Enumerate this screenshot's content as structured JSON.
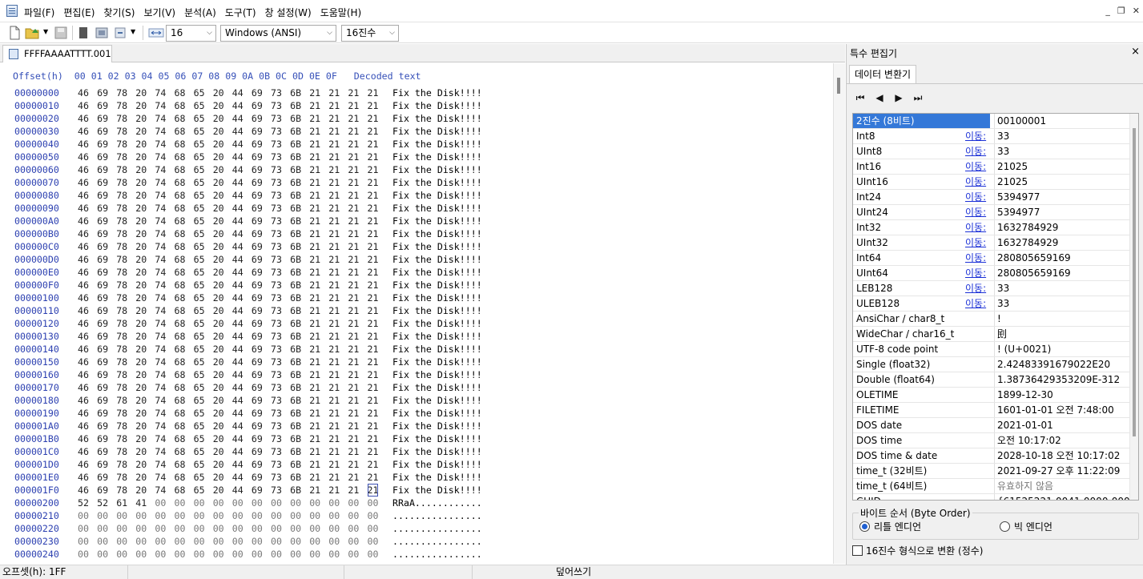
{
  "menu": [
    "파일(F)",
    "편집(E)",
    "찾기(S)",
    "보기(V)",
    "분석(A)",
    "도구(T)",
    "창 설정(W)",
    "도움말(H)"
  ],
  "toolbar": {
    "bytes_per_row": "16",
    "encoding": "Windows (ANSI)",
    "offset_base": "16진수"
  },
  "file_tab": "FFFFAAAATTTT.001",
  "hex_header": "Offset(h)  00 01 02 03 04 05 06 07 08 09 0A 0B 0C 0D 0E 0F   Decoded text",
  "rows": [
    {
      "offset": "00000000",
      "bytes": [
        "46",
        "69",
        "78",
        "20",
        "74",
        "68",
        "65",
        "20",
        "44",
        "69",
        "73",
        "6B",
        "21",
        "21",
        "21",
        "21"
      ],
      "text": "Fix the Disk!!!!"
    },
    {
      "offset": "00000010",
      "bytes": [
        "46",
        "69",
        "78",
        "20",
        "74",
        "68",
        "65",
        "20",
        "44",
        "69",
        "73",
        "6B",
        "21",
        "21",
        "21",
        "21"
      ],
      "text": "Fix the Disk!!!!"
    },
    {
      "offset": "00000020",
      "bytes": [
        "46",
        "69",
        "78",
        "20",
        "74",
        "68",
        "65",
        "20",
        "44",
        "69",
        "73",
        "6B",
        "21",
        "21",
        "21",
        "21"
      ],
      "text": "Fix the Disk!!!!"
    },
    {
      "offset": "00000030",
      "bytes": [
        "46",
        "69",
        "78",
        "20",
        "74",
        "68",
        "65",
        "20",
        "44",
        "69",
        "73",
        "6B",
        "21",
        "21",
        "21",
        "21"
      ],
      "text": "Fix the Disk!!!!"
    },
    {
      "offset": "00000040",
      "bytes": [
        "46",
        "69",
        "78",
        "20",
        "74",
        "68",
        "65",
        "20",
        "44",
        "69",
        "73",
        "6B",
        "21",
        "21",
        "21",
        "21"
      ],
      "text": "Fix the Disk!!!!"
    },
    {
      "offset": "00000050",
      "bytes": [
        "46",
        "69",
        "78",
        "20",
        "74",
        "68",
        "65",
        "20",
        "44",
        "69",
        "73",
        "6B",
        "21",
        "21",
        "21",
        "21"
      ],
      "text": "Fix the Disk!!!!"
    },
    {
      "offset": "00000060",
      "bytes": [
        "46",
        "69",
        "78",
        "20",
        "74",
        "68",
        "65",
        "20",
        "44",
        "69",
        "73",
        "6B",
        "21",
        "21",
        "21",
        "21"
      ],
      "text": "Fix the Disk!!!!"
    },
    {
      "offset": "00000070",
      "bytes": [
        "46",
        "69",
        "78",
        "20",
        "74",
        "68",
        "65",
        "20",
        "44",
        "69",
        "73",
        "6B",
        "21",
        "21",
        "21",
        "21"
      ],
      "text": "Fix the Disk!!!!"
    },
    {
      "offset": "00000080",
      "bytes": [
        "46",
        "69",
        "78",
        "20",
        "74",
        "68",
        "65",
        "20",
        "44",
        "69",
        "73",
        "6B",
        "21",
        "21",
        "21",
        "21"
      ],
      "text": "Fix the Disk!!!!"
    },
    {
      "offset": "00000090",
      "bytes": [
        "46",
        "69",
        "78",
        "20",
        "74",
        "68",
        "65",
        "20",
        "44",
        "69",
        "73",
        "6B",
        "21",
        "21",
        "21",
        "21"
      ],
      "text": "Fix the Disk!!!!"
    },
    {
      "offset": "000000A0",
      "bytes": [
        "46",
        "69",
        "78",
        "20",
        "74",
        "68",
        "65",
        "20",
        "44",
        "69",
        "73",
        "6B",
        "21",
        "21",
        "21",
        "21"
      ],
      "text": "Fix the Disk!!!!"
    },
    {
      "offset": "000000B0",
      "bytes": [
        "46",
        "69",
        "78",
        "20",
        "74",
        "68",
        "65",
        "20",
        "44",
        "69",
        "73",
        "6B",
        "21",
        "21",
        "21",
        "21"
      ],
      "text": "Fix the Disk!!!!"
    },
    {
      "offset": "000000C0",
      "bytes": [
        "46",
        "69",
        "78",
        "20",
        "74",
        "68",
        "65",
        "20",
        "44",
        "69",
        "73",
        "6B",
        "21",
        "21",
        "21",
        "21"
      ],
      "text": "Fix the Disk!!!!"
    },
    {
      "offset": "000000D0",
      "bytes": [
        "46",
        "69",
        "78",
        "20",
        "74",
        "68",
        "65",
        "20",
        "44",
        "69",
        "73",
        "6B",
        "21",
        "21",
        "21",
        "21"
      ],
      "text": "Fix the Disk!!!!"
    },
    {
      "offset": "000000E0",
      "bytes": [
        "46",
        "69",
        "78",
        "20",
        "74",
        "68",
        "65",
        "20",
        "44",
        "69",
        "73",
        "6B",
        "21",
        "21",
        "21",
        "21"
      ],
      "text": "Fix the Disk!!!!"
    },
    {
      "offset": "000000F0",
      "bytes": [
        "46",
        "69",
        "78",
        "20",
        "74",
        "68",
        "65",
        "20",
        "44",
        "69",
        "73",
        "6B",
        "21",
        "21",
        "21",
        "21"
      ],
      "text": "Fix the Disk!!!!"
    },
    {
      "offset": "00000100",
      "bytes": [
        "46",
        "69",
        "78",
        "20",
        "74",
        "68",
        "65",
        "20",
        "44",
        "69",
        "73",
        "6B",
        "21",
        "21",
        "21",
        "21"
      ],
      "text": "Fix the Disk!!!!"
    },
    {
      "offset": "00000110",
      "bytes": [
        "46",
        "69",
        "78",
        "20",
        "74",
        "68",
        "65",
        "20",
        "44",
        "69",
        "73",
        "6B",
        "21",
        "21",
        "21",
        "21"
      ],
      "text": "Fix the Disk!!!!"
    },
    {
      "offset": "00000120",
      "bytes": [
        "46",
        "69",
        "78",
        "20",
        "74",
        "68",
        "65",
        "20",
        "44",
        "69",
        "73",
        "6B",
        "21",
        "21",
        "21",
        "21"
      ],
      "text": "Fix the Disk!!!!"
    },
    {
      "offset": "00000130",
      "bytes": [
        "46",
        "69",
        "78",
        "20",
        "74",
        "68",
        "65",
        "20",
        "44",
        "69",
        "73",
        "6B",
        "21",
        "21",
        "21",
        "21"
      ],
      "text": "Fix the Disk!!!!"
    },
    {
      "offset": "00000140",
      "bytes": [
        "46",
        "69",
        "78",
        "20",
        "74",
        "68",
        "65",
        "20",
        "44",
        "69",
        "73",
        "6B",
        "21",
        "21",
        "21",
        "21"
      ],
      "text": "Fix the Disk!!!!"
    },
    {
      "offset": "00000150",
      "bytes": [
        "46",
        "69",
        "78",
        "20",
        "74",
        "68",
        "65",
        "20",
        "44",
        "69",
        "73",
        "6B",
        "21",
        "21",
        "21",
        "21"
      ],
      "text": "Fix the Disk!!!!"
    },
    {
      "offset": "00000160",
      "bytes": [
        "46",
        "69",
        "78",
        "20",
        "74",
        "68",
        "65",
        "20",
        "44",
        "69",
        "73",
        "6B",
        "21",
        "21",
        "21",
        "21"
      ],
      "text": "Fix the Disk!!!!"
    },
    {
      "offset": "00000170",
      "bytes": [
        "46",
        "69",
        "78",
        "20",
        "74",
        "68",
        "65",
        "20",
        "44",
        "69",
        "73",
        "6B",
        "21",
        "21",
        "21",
        "21"
      ],
      "text": "Fix the Disk!!!!"
    },
    {
      "offset": "00000180",
      "bytes": [
        "46",
        "69",
        "78",
        "20",
        "74",
        "68",
        "65",
        "20",
        "44",
        "69",
        "73",
        "6B",
        "21",
        "21",
        "21",
        "21"
      ],
      "text": "Fix the Disk!!!!"
    },
    {
      "offset": "00000190",
      "bytes": [
        "46",
        "69",
        "78",
        "20",
        "74",
        "68",
        "65",
        "20",
        "44",
        "69",
        "73",
        "6B",
        "21",
        "21",
        "21",
        "21"
      ],
      "text": "Fix the Disk!!!!"
    },
    {
      "offset": "000001A0",
      "bytes": [
        "46",
        "69",
        "78",
        "20",
        "74",
        "68",
        "65",
        "20",
        "44",
        "69",
        "73",
        "6B",
        "21",
        "21",
        "21",
        "21"
      ],
      "text": "Fix the Disk!!!!"
    },
    {
      "offset": "000001B0",
      "bytes": [
        "46",
        "69",
        "78",
        "20",
        "74",
        "68",
        "65",
        "20",
        "44",
        "69",
        "73",
        "6B",
        "21",
        "21",
        "21",
        "21"
      ],
      "text": "Fix the Disk!!!!"
    },
    {
      "offset": "000001C0",
      "bytes": [
        "46",
        "69",
        "78",
        "20",
        "74",
        "68",
        "65",
        "20",
        "44",
        "69",
        "73",
        "6B",
        "21",
        "21",
        "21",
        "21"
      ],
      "text": "Fix the Disk!!!!"
    },
    {
      "offset": "000001D0",
      "bytes": [
        "46",
        "69",
        "78",
        "20",
        "74",
        "68",
        "65",
        "20",
        "44",
        "69",
        "73",
        "6B",
        "21",
        "21",
        "21",
        "21"
      ],
      "text": "Fix the Disk!!!!"
    },
    {
      "offset": "000001E0",
      "bytes": [
        "46",
        "69",
        "78",
        "20",
        "74",
        "68",
        "65",
        "20",
        "44",
        "69",
        "73",
        "6B",
        "21",
        "21",
        "21",
        "21"
      ],
      "text": "Fix the Disk!!!!"
    },
    {
      "offset": "000001F0",
      "bytes": [
        "46",
        "69",
        "78",
        "20",
        "74",
        "68",
        "65",
        "20",
        "44",
        "69",
        "73",
        "6B",
        "21",
        "21",
        "21",
        "21"
      ],
      "text": "Fix the Disk!!!!"
    },
    {
      "offset": "00000200",
      "bytes": [
        "52",
        "52",
        "61",
        "41",
        "00",
        "00",
        "00",
        "00",
        "00",
        "00",
        "00",
        "00",
        "00",
        "00",
        "00",
        "00"
      ],
      "text": "RRaA............"
    },
    {
      "offset": "00000210",
      "bytes": [
        "00",
        "00",
        "00",
        "00",
        "00",
        "00",
        "00",
        "00",
        "00",
        "00",
        "00",
        "00",
        "00",
        "00",
        "00",
        "00"
      ],
      "text": "................"
    },
    {
      "offset": "00000220",
      "bytes": [
        "00",
        "00",
        "00",
        "00",
        "00",
        "00",
        "00",
        "00",
        "00",
        "00",
        "00",
        "00",
        "00",
        "00",
        "00",
        "00"
      ],
      "text": "................"
    },
    {
      "offset": "00000230",
      "bytes": [
        "00",
        "00",
        "00",
        "00",
        "00",
        "00",
        "00",
        "00",
        "00",
        "00",
        "00",
        "00",
        "00",
        "00",
        "00",
        "00"
      ],
      "text": "................"
    },
    {
      "offset": "00000240",
      "bytes": [
        "00",
        "00",
        "00",
        "00",
        "00",
        "00",
        "00",
        "00",
        "00",
        "00",
        "00",
        "00",
        "00",
        "00",
        "00",
        "00"
      ],
      "text": "................"
    }
  ],
  "panel": {
    "title": "특수 편집기",
    "close": "×",
    "tab": "데이터 변환기",
    "nav": [
      "⏮",
      "◀",
      "▶",
      "⏭"
    ],
    "goto_label": "이동:",
    "rows": [
      {
        "name": "2진수 (8비트)",
        "value": "00100001",
        "link": false
      },
      {
        "name": "Int8",
        "value": "33",
        "link": true
      },
      {
        "name": "UInt8",
        "value": "33",
        "link": true
      },
      {
        "name": "Int16",
        "value": "21025",
        "link": true
      },
      {
        "name": "UInt16",
        "value": "21025",
        "link": true
      },
      {
        "name": "Int24",
        "value": "5394977",
        "link": true
      },
      {
        "name": "UInt24",
        "value": "5394977",
        "link": true
      },
      {
        "name": "Int32",
        "value": "1632784929",
        "link": true
      },
      {
        "name": "UInt32",
        "value": "1632784929",
        "link": true
      },
      {
        "name": "Int64",
        "value": "280805659169",
        "link": true
      },
      {
        "name": "UInt64",
        "value": "280805659169",
        "link": true
      },
      {
        "name": "LEB128",
        "value": "33",
        "link": true
      },
      {
        "name": "ULEB128",
        "value": "33",
        "link": true
      },
      {
        "name": "AnsiChar / char8_t",
        "value": "!",
        "link": false
      },
      {
        "name": "WideChar / char16_t",
        "value": "刡",
        "link": false
      },
      {
        "name": "UTF-8 code point",
        "value": "! (U+0021)",
        "link": false
      },
      {
        "name": "Single (float32)",
        "value": "2.42483391679022E20",
        "link": false
      },
      {
        "name": "Double (float64)",
        "value": "1.38736429353209E-312",
        "link": false
      },
      {
        "name": "OLETIME",
        "value": "1899-12-30",
        "link": false
      },
      {
        "name": "FILETIME",
        "value": "1601-01-01 오전 7:48:00",
        "link": false
      },
      {
        "name": "DOS date",
        "value": "2021-01-01",
        "link": false
      },
      {
        "name": "DOS time",
        "value": "오전 10:17:02",
        "link": false
      },
      {
        "name": "DOS time & date",
        "value": "2028-10-18 오전 10:17:02",
        "link": false
      },
      {
        "name": "time_t (32비트)",
        "value": "2021-09-27 오후 11:22:09",
        "link": false
      },
      {
        "name": "time_t (64비트)",
        "value": "유효하지 않음",
        "link": false,
        "invalid": true
      },
      {
        "name": "GUID",
        "value": "{61525221-0041-0000-0000",
        "link": false
      }
    ],
    "byte_order_label": "바이트 순서 (Byte Order)",
    "little_endian": "리틀 엔디언",
    "big_endian": "빅 엔디언",
    "hex_convert": "16진수 형식으로 변환 (정수)"
  },
  "status": {
    "offset": "오프셋(h): 1FF",
    "mode": "덮어쓰기"
  },
  "colors": {
    "selection": "#3478d8",
    "offset_blue": "#2b3fb0",
    "link": "#1a2fd6"
  }
}
